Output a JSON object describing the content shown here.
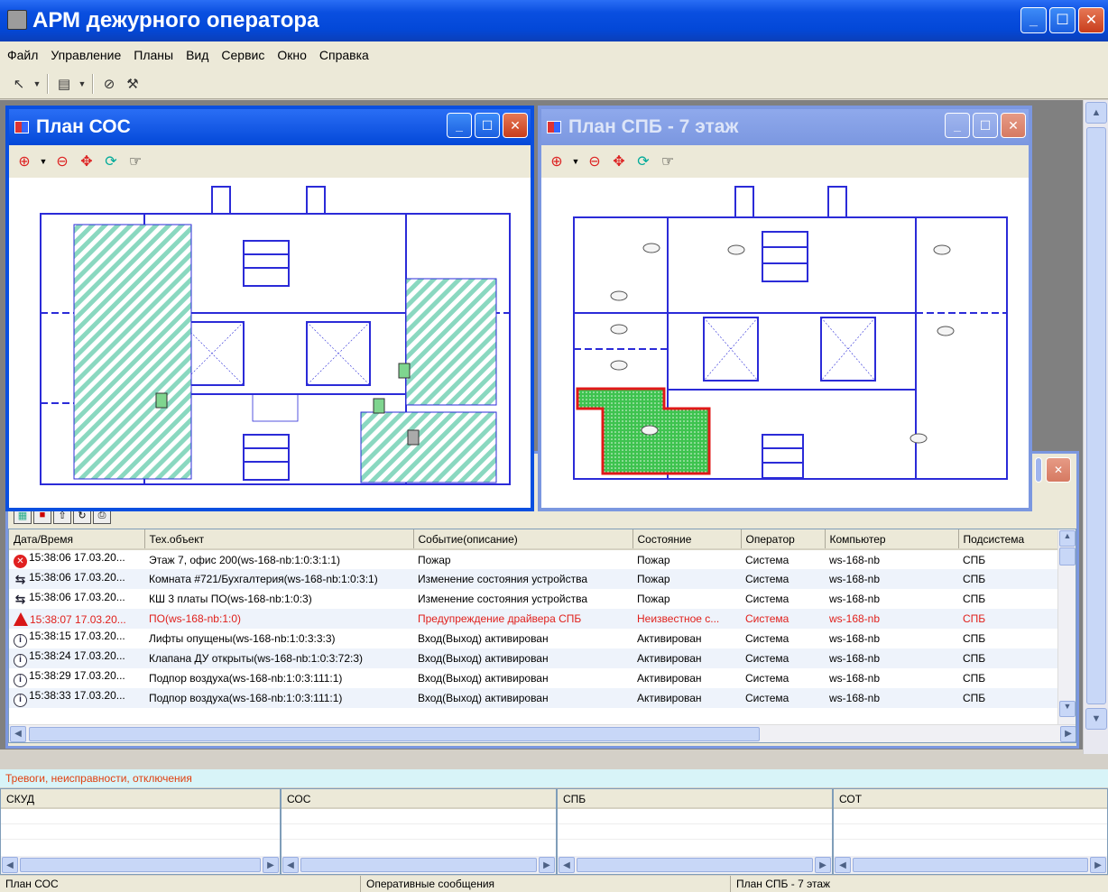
{
  "app": {
    "title": "АРМ дежурного оператора"
  },
  "menu": [
    "Файл",
    "Управление",
    "Планы",
    "Вид",
    "Сервис",
    "Окно",
    "Справка"
  ],
  "plan_windows": [
    {
      "title": "План СОС"
    },
    {
      "title": "План СПБ - 7 этаж"
    }
  ],
  "events": {
    "columns": [
      "Дата/Время",
      "Тех.объект",
      "Событие(описание)",
      "Состояние",
      "Оператор",
      "Компьютер",
      "Подсистема"
    ],
    "rows": [
      {
        "icon": "error-icon",
        "cells": [
          "15:38:06 17.03.20...",
          "Этаж 7, офис 200(ws-168-nb:1:0:3:1:1)",
          "Пожар",
          "Пожар",
          "Система",
          "ws-168-nb",
          "СПБ"
        ]
      },
      {
        "icon": "swap-icon",
        "cells": [
          "15:38:06 17.03.20...",
          "Комната #721/Бухгалтерия(ws-168-nb:1:0:3:1)",
          "Изменение состояния устройства",
          "Пожар",
          "Система",
          "ws-168-nb",
          "СПБ"
        ]
      },
      {
        "icon": "swap-icon",
        "cells": [
          "15:38:06 17.03.20...",
          "КШ 3 платы ПО(ws-168-nb:1:0:3)",
          "Изменение состояния устройства",
          "Пожар",
          "Система",
          "ws-168-nb",
          "СПБ"
        ]
      },
      {
        "icon": "warning-icon",
        "warn": true,
        "cells": [
          "15:38:07 17.03.20...",
          "ПО(ws-168-nb:1:0)",
          "Предупреждение драйвера СПБ",
          "Неизвестное с...",
          "Система",
          "ws-168-nb",
          "СПБ"
        ]
      },
      {
        "icon": "info-icon",
        "cells": [
          "15:38:15 17.03.20...",
          "Лифты опущены(ws-168-nb:1:0:3:3:3)",
          "Вход(Выход) активирован",
          "Активирован",
          "Система",
          "ws-168-nb",
          "СПБ"
        ]
      },
      {
        "icon": "info-icon",
        "cells": [
          "15:38:24 17.03.20...",
          "Клапана ДУ открыты(ws-168-nb:1:0:3:72:3)",
          "Вход(Выход) активирован",
          "Активирован",
          "Система",
          "ws-168-nb",
          "СПБ"
        ]
      },
      {
        "icon": "info-icon",
        "cells": [
          "15:38:29 17.03.20...",
          "Подпор воздуха(ws-168-nb:1:0:3:111:1)",
          "Вход(Выход) активирован",
          "Активирован",
          "Система",
          "ws-168-nb",
          "СПБ"
        ]
      },
      {
        "icon": "info-icon",
        "cells": [
          "15:38:33 17.03.20...",
          "Подпор воздуха(ws-168-nb:1:0:3:111:1)",
          "Вход(Выход) активирован",
          "Активирован",
          "Система",
          "ws-168-nb",
          "СПБ"
        ]
      }
    ]
  },
  "alarms": {
    "label": "Тревоги, неисправности, отключения",
    "columns": [
      "СКУД",
      "СОС",
      "СПБ",
      "СОТ"
    ]
  },
  "status": [
    "План СОС",
    "Оперативные сообщения",
    "План СПБ - 7 этаж"
  ],
  "colors": {
    "title_bar": "#0a4fe0",
    "alarm_text": "#e04010",
    "warn_row": "#e0201c",
    "hatch_zone": "#7fd9b9",
    "fire_zone": "#36c24a"
  }
}
